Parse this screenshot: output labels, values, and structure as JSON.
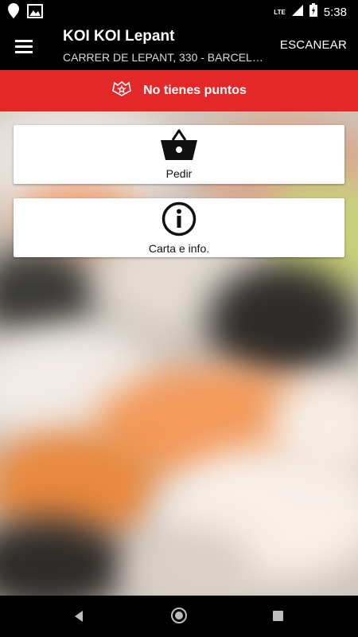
{
  "status_bar": {
    "time": "5:38",
    "network": "LTE",
    "icons": [
      "location-icon",
      "gallery-icon",
      "signal-icon",
      "battery-charging-icon"
    ]
  },
  "app_bar": {
    "menu_icon": "hamburger-menu-icon",
    "title": "KOI KOI Lepant",
    "subtitle": "CARRER DE LEPANT, 330 - BARCELONA",
    "action": "ESCANEAR"
  },
  "points": {
    "icon": "badge-star-icon",
    "text": "No tienes puntos",
    "color": "#e32829"
  },
  "cards": [
    {
      "icon": "shopping-basket-icon",
      "label": "Pedir"
    },
    {
      "icon": "info-circle-icon",
      "label": "Carta e info."
    }
  ],
  "nav_bar": {
    "icons": [
      "back-icon",
      "home-icon",
      "recent-apps-icon"
    ]
  }
}
